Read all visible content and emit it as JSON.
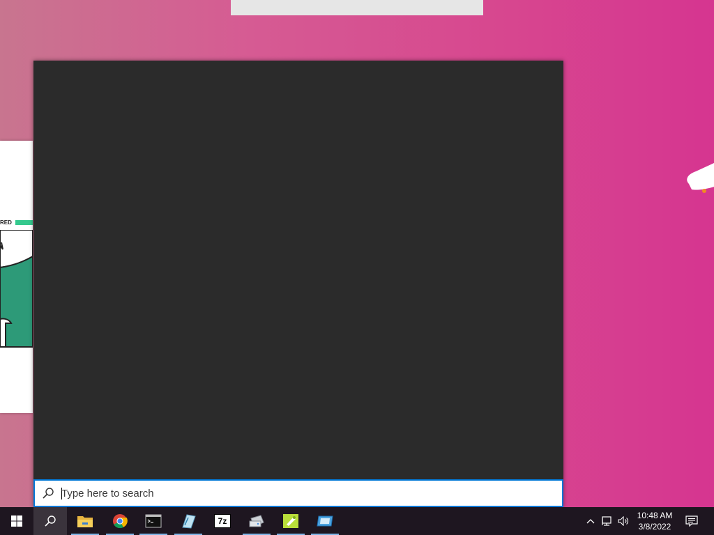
{
  "search": {
    "placeholder": "Type here to search"
  },
  "background_window": {
    "partial_text": "RED"
  },
  "taskbar": {
    "apps": [
      {
        "name": "start-button",
        "icon": "windows-logo-icon"
      },
      {
        "name": "search-button",
        "icon": "search-icon"
      },
      {
        "name": "file-explorer",
        "icon": "folder-icon"
      },
      {
        "name": "chrome",
        "icon": "chrome-icon"
      },
      {
        "name": "command-prompt",
        "icon": "terminal-icon"
      },
      {
        "name": "notepad-app",
        "icon": "pen-paper-icon"
      },
      {
        "name": "7zip",
        "icon": "7zip-icon",
        "label": "7z"
      },
      {
        "name": "disk-app",
        "icon": "disk-drive-icon"
      },
      {
        "name": "notepadplusplus",
        "icon": "notepad-plus-icon"
      },
      {
        "name": "remote-app",
        "icon": "window-app-icon"
      }
    ],
    "tray": {
      "chevron": "chevron-up-icon",
      "network": "network-icon",
      "volume": "speaker-icon",
      "notifications": "action-center-icon"
    },
    "clock": {
      "time": "10:48 AM",
      "date": "3/8/2022"
    }
  },
  "colors": {
    "accent": "#0078d7",
    "panel": "#2b2b2b",
    "taskbar": "#1e1620"
  }
}
